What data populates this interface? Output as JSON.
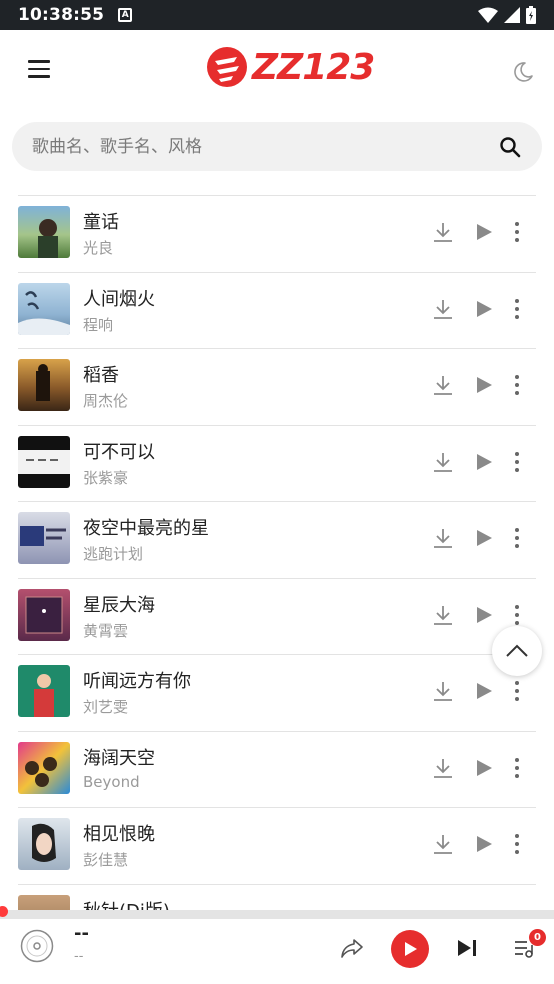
{
  "status_bar": {
    "time": "10:38:55",
    "notification_glyph": "A"
  },
  "header": {
    "logo_text": "ZZ123",
    "logo_color": "#e62d2d"
  },
  "search": {
    "placeholder": "歌曲名、歌手名、风格",
    "value": ""
  },
  "songs": [
    {
      "title": "童话",
      "artist": "光良"
    },
    {
      "title": "人间烟火",
      "artist": "程响"
    },
    {
      "title": "稻香",
      "artist": "周杰伦"
    },
    {
      "title": "可不可以",
      "artist": "张紫豪"
    },
    {
      "title": "夜空中最亮的星",
      "artist": "逃跑计划"
    },
    {
      "title": "星辰大海",
      "artist": "黄霄雲"
    },
    {
      "title": "听闻远方有你",
      "artist": "刘艺雯"
    },
    {
      "title": "海阔天空",
      "artist": "Beyond"
    },
    {
      "title": "相见恨晚",
      "artist": "彭佳慧"
    },
    {
      "title": "秋针(Dj版)",
      "artist": ""
    }
  ],
  "player": {
    "title": "--",
    "subtitle": "--",
    "queue_count": "0",
    "progress": 0
  },
  "colors": {
    "accent": "#e62d2d",
    "icon_gray": "#8a8a8a",
    "divider": "#e3e3e3"
  }
}
